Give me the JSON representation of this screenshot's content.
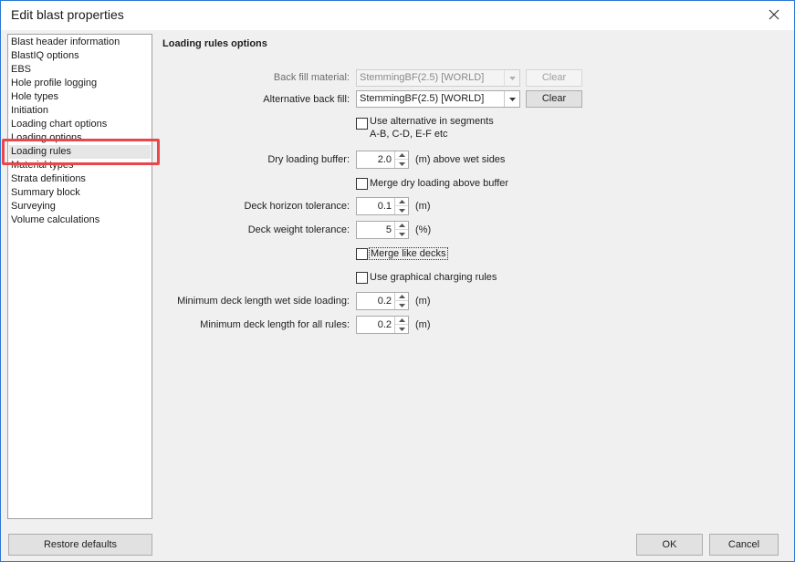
{
  "window": {
    "title": "Edit blast properties"
  },
  "sidebar": {
    "items": [
      {
        "label": "Blast header information"
      },
      {
        "label": "BlastIQ options"
      },
      {
        "label": "EBS"
      },
      {
        "label": "Hole profile logging"
      },
      {
        "label": "Hole types"
      },
      {
        "label": "Initiation"
      },
      {
        "label": "Loading chart options"
      },
      {
        "label": "Loading options"
      },
      {
        "label": "Loading rules"
      },
      {
        "label": "Material types"
      },
      {
        "label": "Strata definitions"
      },
      {
        "label": "Summary block"
      },
      {
        "label": "Surveying"
      },
      {
        "label": "Volume calculations"
      }
    ],
    "selected": "Loading rules",
    "highlight_color": "#e8474b"
  },
  "main": {
    "section_title": "Loading rules options",
    "back_fill": {
      "label": "Back fill material:",
      "value": "StemmingBF(2.5) [WORLD]",
      "clear_label": "Clear",
      "enabled": false
    },
    "alt_back_fill": {
      "label": "Alternative back fill:",
      "value": "StemmingBF(2.5) [WORLD]",
      "clear_label": "Clear",
      "enabled": true
    },
    "use_alt_segments": {
      "label_line1": "Use alternative in segments",
      "label_line2": "A-B, C-D, E-F etc",
      "checked": false
    },
    "dry_loading_buffer": {
      "label": "Dry loading buffer:",
      "value": "2.0",
      "unit": "(m)  above wet sides"
    },
    "merge_dry": {
      "label": "Merge dry loading above buffer",
      "checked": false
    },
    "deck_horizon": {
      "label": "Deck horizon tolerance:",
      "value": "0.1",
      "unit": "(m)"
    },
    "deck_weight": {
      "label": "Deck weight tolerance:",
      "value": "5",
      "unit": "(%)"
    },
    "merge_like_decks": {
      "label": "Merge like decks",
      "checked": false
    },
    "graphical_rules": {
      "label": "Use graphical charging rules",
      "checked": false
    },
    "min_deck_wet": {
      "label": "Minimum deck length wet side loading:",
      "value": "0.2",
      "unit": "(m)"
    },
    "min_deck_all": {
      "label": "Minimum deck length for all rules:",
      "value": "0.2",
      "unit": "(m)"
    }
  },
  "footer": {
    "restore_label": "Restore defaults",
    "ok_label": "OK",
    "cancel_label": "Cancel"
  }
}
